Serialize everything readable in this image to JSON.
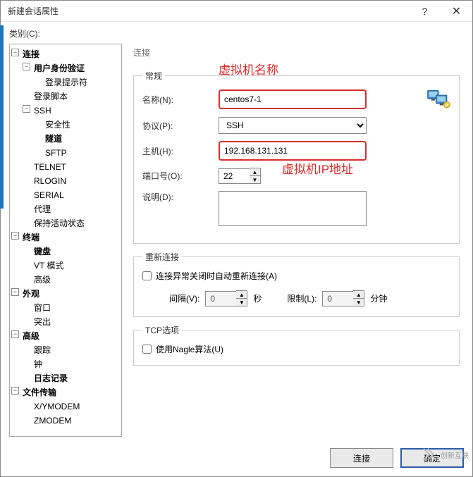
{
  "title": "新建会话属性",
  "category_label": "类别(C):",
  "tree": {
    "connection": "连接",
    "user_auth": "用户身份验证",
    "login_prompt": "登录提示符",
    "login_script": "登录脚本",
    "ssh": "SSH",
    "security": "安全性",
    "tunnel": "隧道",
    "sftp": "SFTP",
    "telnet": "TELNET",
    "rlogin": "RLOGIN",
    "serial": "SERIAL",
    "proxy": "代理",
    "keepalive": "保持活动状态",
    "terminal": "终端",
    "keyboard": "键盘",
    "vtmode": "VT 模式",
    "advanced_term": "高级",
    "appearance": "外观",
    "window": "窗口",
    "highlight": "突出",
    "advanced": "高级",
    "trace": "跟踪",
    "bell": "钟",
    "logging": "日志记录",
    "filetrans": "文件传输",
    "xymodem": "X/YMODEM",
    "zmodem": "ZMODEM"
  },
  "panel_title": "连接",
  "general": {
    "legend": "常规",
    "name_label": "名称(N):",
    "name_value": "centos7-1",
    "protocol_label": "协议(P):",
    "protocol_value": "SSH",
    "host_label": "主机(H):",
    "host_value": "192.168.131.131",
    "port_label": "端口号(O):",
    "port_value": "22",
    "desc_label": "说明(D):"
  },
  "reconnect": {
    "legend": "重新连接",
    "auto_reconnect": "连接异常关闭时自动重新连接(A)",
    "interval_label": "间隔(V):",
    "interval_value": "0",
    "interval_unit": "秒",
    "limit_label": "限制(L):",
    "limit_value": "0",
    "limit_unit": "分钟"
  },
  "tcp": {
    "legend": "TCP选项",
    "nagle": "使用Nagle算法(U)"
  },
  "buttons": {
    "connect": "连接",
    "ok": "确定"
  },
  "annotations": {
    "vm_name": "虚拟机名称",
    "vm_ip": "虚拟机IP地址"
  },
  "watermark": "创新互联"
}
